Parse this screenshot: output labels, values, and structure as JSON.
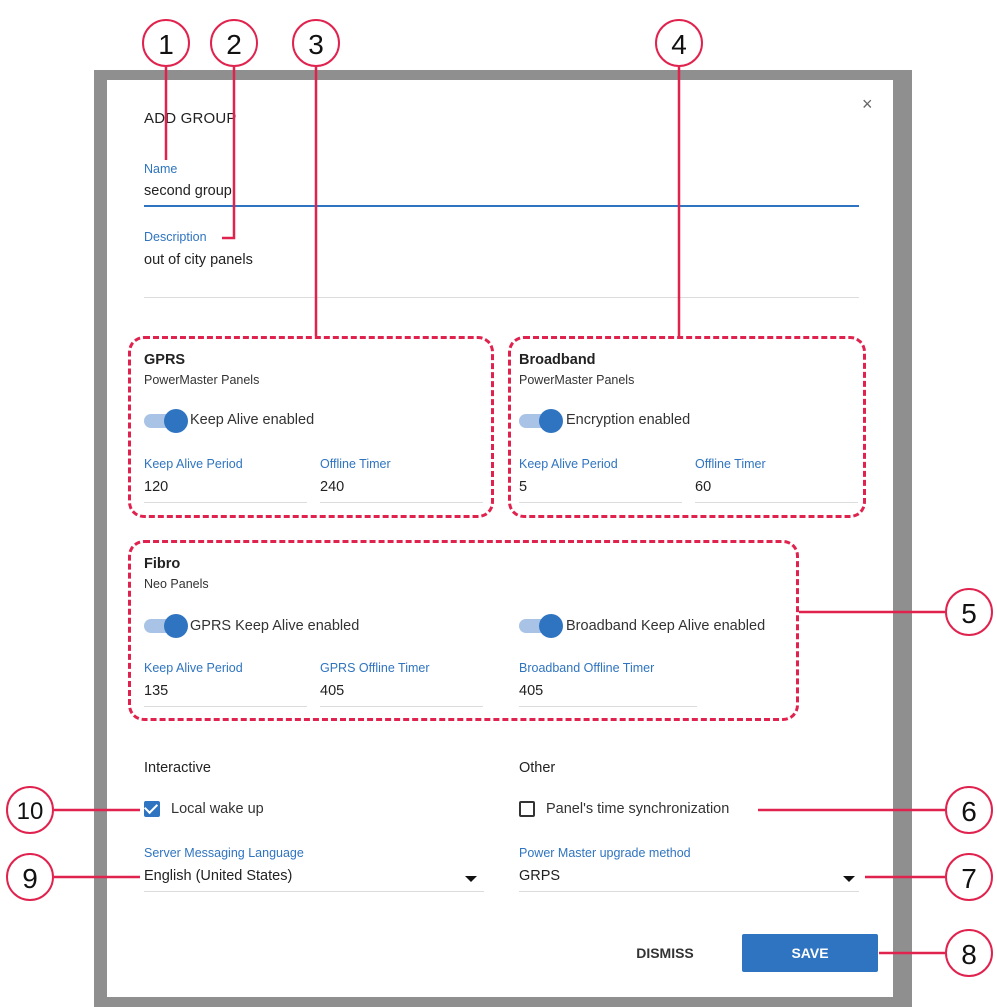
{
  "dialog": {
    "title": "ADD GROUP",
    "close_glyph": "×",
    "name": {
      "label": "Name",
      "value": "second group"
    },
    "description": {
      "label": "Description",
      "value": "out of city panels"
    }
  },
  "gprs": {
    "title": "GPRS",
    "subtitle": "PowerMaster Panels",
    "toggle_label": "Keep Alive enabled",
    "toggle_on": true,
    "keep_alive_period": {
      "label": "Keep Alive Period",
      "value": "120"
    },
    "offline_timer": {
      "label": "Offline Timer",
      "value": "240"
    }
  },
  "broadband": {
    "title": "Broadband",
    "subtitle": "PowerMaster Panels",
    "toggle_label": "Encryption enabled",
    "toggle_on": true,
    "keep_alive_period": {
      "label": "Keep Alive Period",
      "value": "5"
    },
    "offline_timer": {
      "label": "Offline Timer",
      "value": "60"
    }
  },
  "fibro": {
    "title": "Fibro",
    "subtitle": "Neo Panels",
    "gprs_toggle_label": "GPRS Keep Alive enabled",
    "broadband_toggle_label": "Broadband Keep Alive enabled",
    "keep_alive_period": {
      "label": "Keep Alive Period",
      "value": "135"
    },
    "gprs_offline_timer": {
      "label": "GPRS Offline Timer",
      "value": "405"
    },
    "broadband_offline_timer": {
      "label": "Broadband Offline Timer",
      "value": "405"
    }
  },
  "interactive": {
    "heading": "Interactive",
    "local_wake_up": {
      "label": "Local wake up",
      "checked": true
    },
    "language": {
      "label": "Server Messaging Language",
      "value": "English (United States)"
    }
  },
  "other": {
    "heading": "Other",
    "time_sync": {
      "label": "Panel's time synchronization",
      "checked": false
    },
    "upgrade_method": {
      "label": "Power Master upgrade method",
      "value": "GRPS"
    }
  },
  "buttons": {
    "dismiss": "DISMISS",
    "save": "SAVE"
  },
  "callouts": [
    "1",
    "2",
    "3",
    "4",
    "5",
    "6",
    "7",
    "8",
    "9",
    "10"
  ],
  "colors": {
    "accent": "#2f74c0",
    "annotation": "#e0234e",
    "backdrop": "#8f8f8f"
  }
}
